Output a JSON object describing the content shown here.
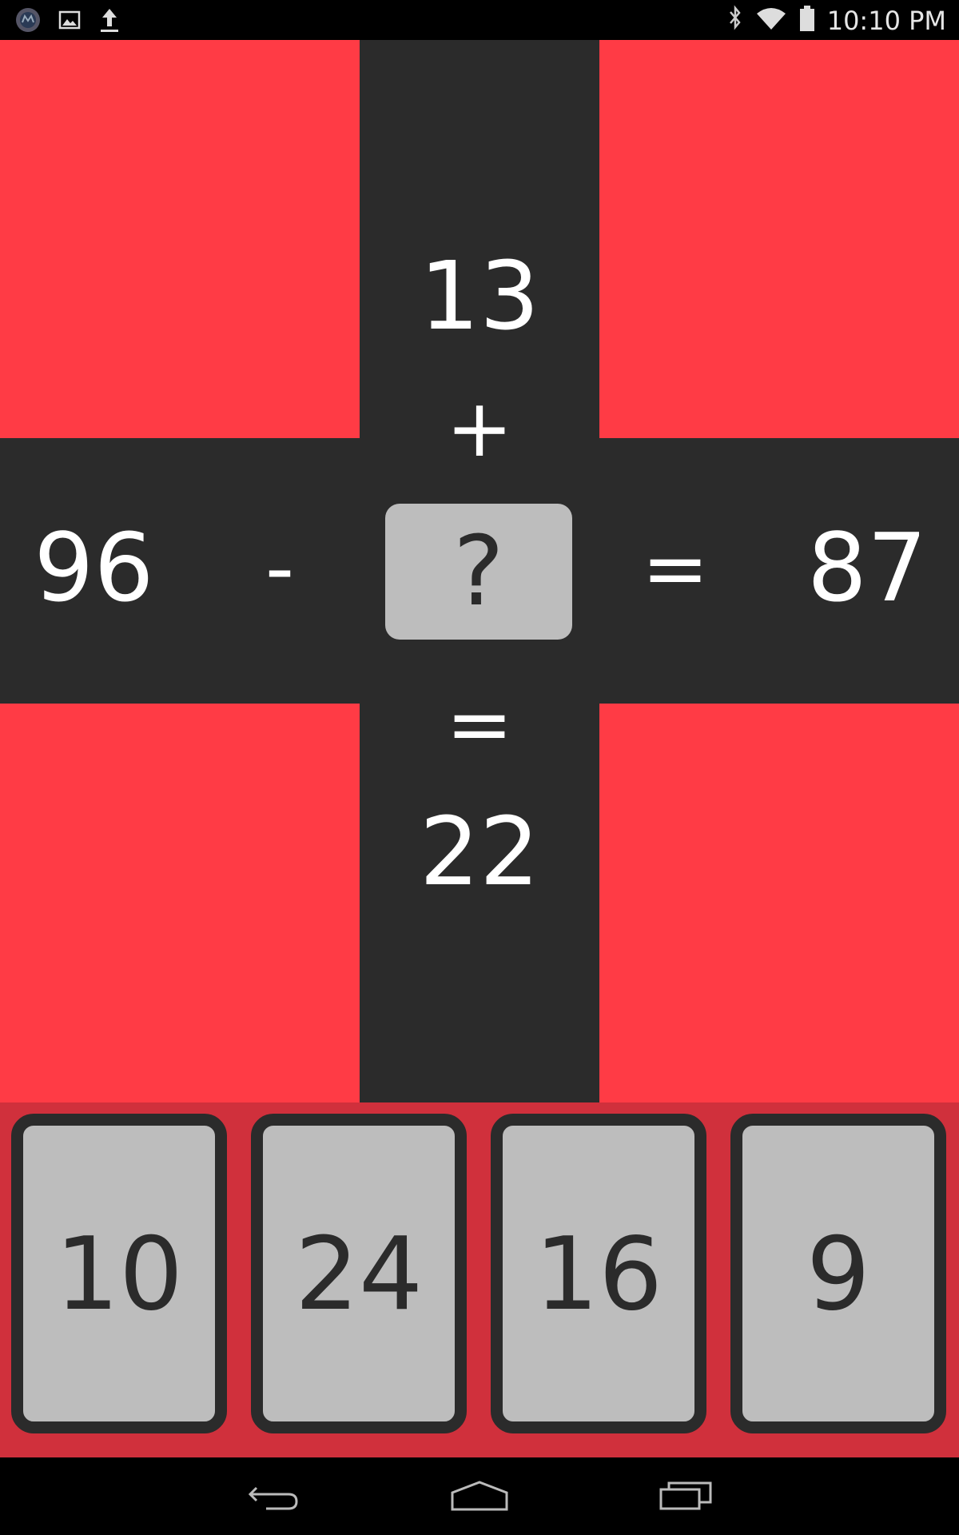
{
  "status_bar": {
    "time": "10:10 PM",
    "left_icons": [
      "app-notification-icon",
      "image-icon",
      "upload-icon"
    ],
    "right_icons": [
      "bluetooth-icon",
      "wifi-icon",
      "battery-icon"
    ]
  },
  "puzzle": {
    "top_number": "13",
    "vertical_operator": "+",
    "left_number": "96",
    "horizontal_operator": "-",
    "unknown_placeholder": "?",
    "horizontal_equals": "=",
    "right_number": "87",
    "vertical_equals": "=",
    "bottom_number": "22"
  },
  "choices": [
    "10",
    "24",
    "16",
    "9"
  ],
  "colors": {
    "background_red": "#ff3b45",
    "tray_red": "#d0303c",
    "cross_dark": "#2b2b2b",
    "tile_gray": "#bdbdbd"
  },
  "nav_bar": {
    "buttons": [
      "back-icon",
      "home-icon",
      "recent-apps-icon"
    ]
  }
}
